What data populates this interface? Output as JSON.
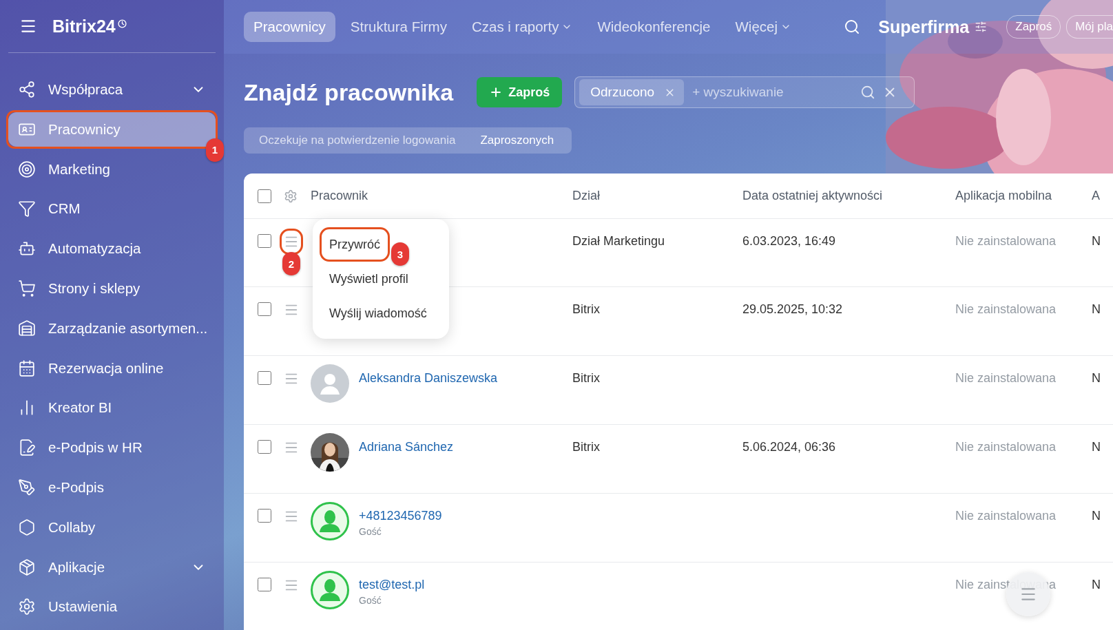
{
  "logo": {
    "text": "Bitrix24"
  },
  "sidebar": {
    "items": [
      {
        "label": "Współpraca",
        "expandable": true,
        "selected": false
      },
      {
        "label": "Pracownicy",
        "expandable": false,
        "selected": true,
        "annotation": "1"
      },
      {
        "label": "Marketing",
        "expandable": false,
        "selected": false
      },
      {
        "label": "CRM",
        "expandable": false,
        "selected": false
      },
      {
        "label": "Automatyzacja",
        "expandable": false,
        "selected": false
      },
      {
        "label": "Strony i sklepy",
        "expandable": false,
        "selected": false
      },
      {
        "label": "Zarządzanie asortymen...",
        "expandable": false,
        "selected": false
      },
      {
        "label": "Rezerwacja online",
        "expandable": false,
        "selected": false
      },
      {
        "label": "Kreator BI",
        "expandable": false,
        "selected": false
      },
      {
        "label": "e-Podpis w HR",
        "expandable": false,
        "selected": false
      },
      {
        "label": "e-Podpis",
        "expandable": false,
        "selected": false
      },
      {
        "label": "Collaby",
        "expandable": false,
        "selected": false
      },
      {
        "label": "Aplikacje",
        "expandable": true,
        "selected": false
      },
      {
        "label": "Ustawienia",
        "expandable": false,
        "selected": false
      }
    ]
  },
  "top_nav": {
    "tabs": [
      {
        "label": "Pracownicy",
        "selected": true,
        "dropdown": false
      },
      {
        "label": "Struktura Firmy",
        "selected": false,
        "dropdown": false
      },
      {
        "label": "Czas i raporty",
        "selected": false,
        "dropdown": true
      },
      {
        "label": "Wideokonferencje",
        "selected": false,
        "dropdown": false
      },
      {
        "label": "Więcej",
        "selected": false,
        "dropdown": true
      }
    ],
    "company": "Superfirma",
    "invite_button": "Zaproś",
    "plan_button": "Mój pla"
  },
  "page": {
    "title": "Znajdź pracownika",
    "invite_button": "Zaproś",
    "search": {
      "tag": "Odrzucono",
      "placeholder": "+ wyszukiwanie"
    },
    "presets": [
      {
        "label": "Oczekuje na potwierdzenie logowania",
        "selected": false
      },
      {
        "label": "Zaproszonych",
        "selected": true
      }
    ]
  },
  "table": {
    "select_all_checked": false,
    "columns": [
      "Pracownik",
      "Dział",
      "Data ostatniej aktywności",
      "Aplikacja mobilna",
      "A"
    ],
    "rows": [
      {
        "checked": false,
        "department": "Dział Marketingu",
        "last_activity": "6.03.2023, 16:49",
        "mobile_app": "Nie zainstalowana",
        "column_5": "N",
        "menu_annotation": "2"
      },
      {
        "checked": false,
        "department": "Bitrix",
        "last_activity": "29.05.2025, 10:32",
        "mobile_app": "Nie zainstalowana",
        "column_5": "N"
      },
      {
        "checked": false,
        "kind": "placeholder",
        "name": "Aleksandra Daniszewska",
        "department": "Bitrix",
        "mobile_app": "Nie zainstalowana",
        "column_5": "N"
      },
      {
        "checked": false,
        "name": "Adriana Sánchez",
        "department": "Bitrix",
        "last_activity": "5.06.2024, 06:36",
        "mobile_app": "Nie zainstalowana",
        "column_5": "N"
      },
      {
        "checked": false,
        "kind": "guest",
        "name": "+48123456789",
        "subtitle": "Gość",
        "mobile_app": "Nie zainstalowana",
        "column_5": "N"
      },
      {
        "checked": false,
        "kind": "guest",
        "name": "test@test.pl",
        "subtitle": "Gość",
        "mobile_app": "Nie zainstalowana",
        "column_5": "N"
      }
    ]
  },
  "context_menu": {
    "items": [
      {
        "label": "Przywróć",
        "annotation": "3"
      },
      {
        "label": "Wyświetl profil"
      },
      {
        "label": "Wyślij wiadomość"
      }
    ]
  }
}
